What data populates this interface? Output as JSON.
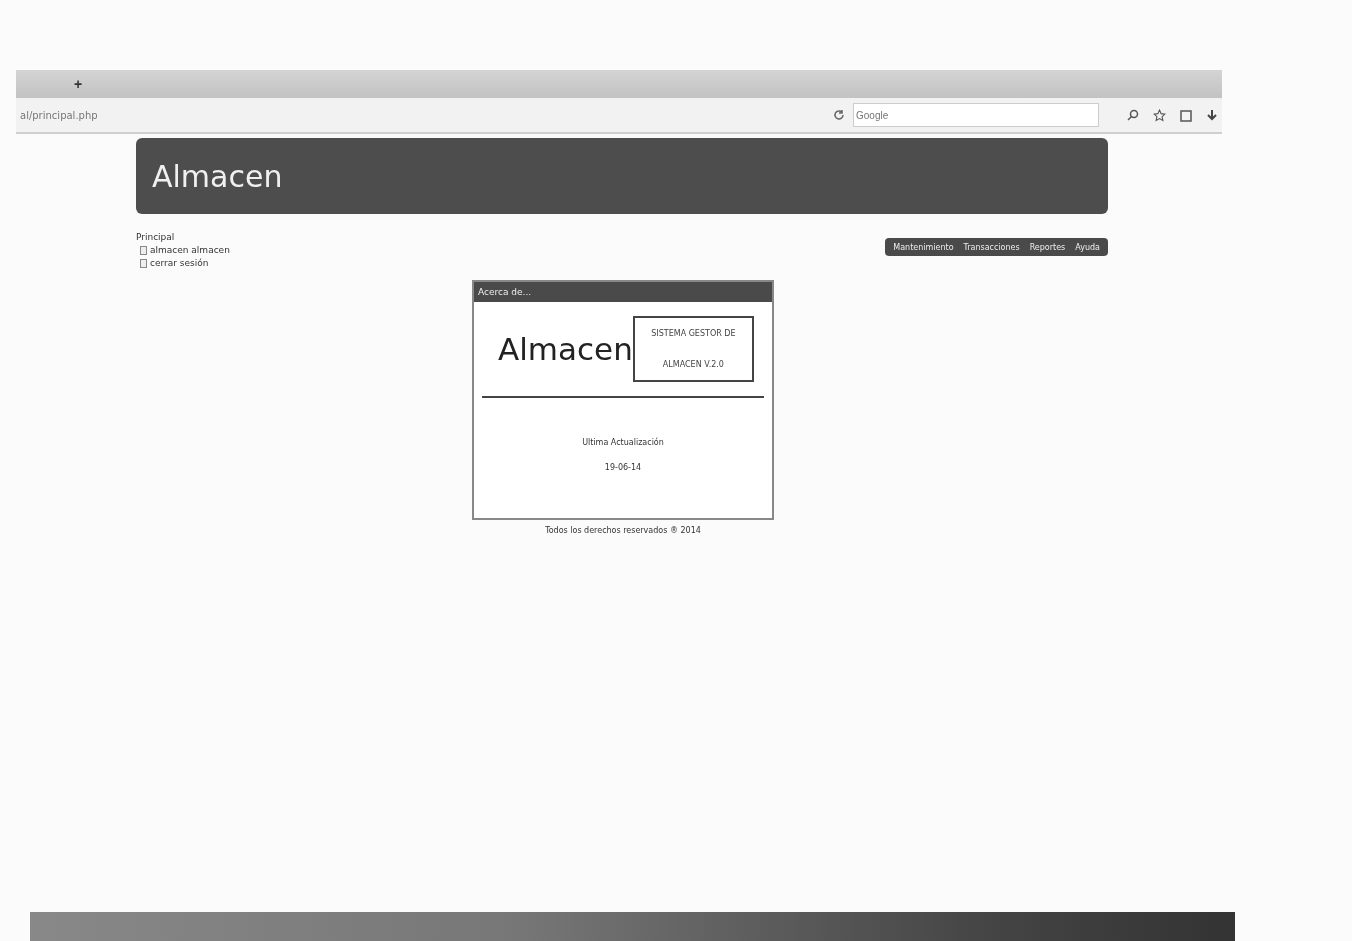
{
  "browser": {
    "new_tab": "+",
    "address": "al/principal.php",
    "search": {
      "placeholder": "Google"
    }
  },
  "header": {
    "title": "Almacen"
  },
  "sidebar": {
    "title": "Principal",
    "items": [
      {
        "label": "almacen almacen"
      },
      {
        "label": "cerrar sesión"
      }
    ]
  },
  "menu": [
    {
      "label": "Mantenimiento"
    },
    {
      "label": "Transacciones"
    },
    {
      "label": "Reportes"
    },
    {
      "label": "Ayuda"
    }
  ],
  "dialog": {
    "title": "Acerca de...",
    "logo": "Almacen",
    "system_lines": [
      "SISTEMA GESTOR DE",
      "ALMACEN V.2.0"
    ],
    "update_label": "Ultima Actualización",
    "update_date": "19-06-14"
  },
  "footer": "Todos los derechos reservados ® 2014"
}
